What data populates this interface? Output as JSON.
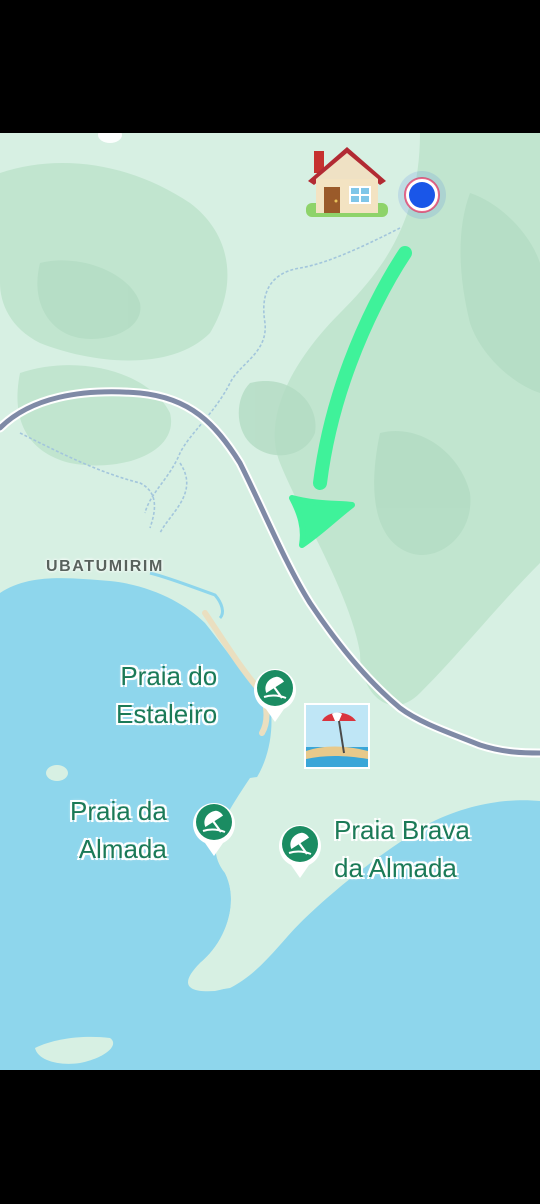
{
  "map": {
    "district_label": "UBATUMIRIM",
    "pois": [
      {
        "id": "estaleiro",
        "lines": [
          "Praia do",
          "Estaleiro"
        ],
        "icon": "beach-umbrella-icon"
      },
      {
        "id": "almada",
        "lines": [
          "Praia da",
          "Almada"
        ],
        "icon": "beach-umbrella-icon"
      },
      {
        "id": "brava",
        "lines": [
          "Praia Brava",
          "da Almada"
        ],
        "icon": "beach-umbrella-icon"
      }
    ],
    "annotations": {
      "start_icon": "house-emoji",
      "end_icon": "beach-with-umbrella-emoji",
      "arrow_icon": "hand-drawn-arrow",
      "arrow_color": "#3ff29a"
    },
    "colors": {
      "land": "#d7f0e3",
      "forest": "#bfe3cd",
      "water": "#8ed6ec",
      "road": "#7f8aa6",
      "poi_green": "#1b8c62",
      "user_dot": "#1a56e8"
    }
  }
}
